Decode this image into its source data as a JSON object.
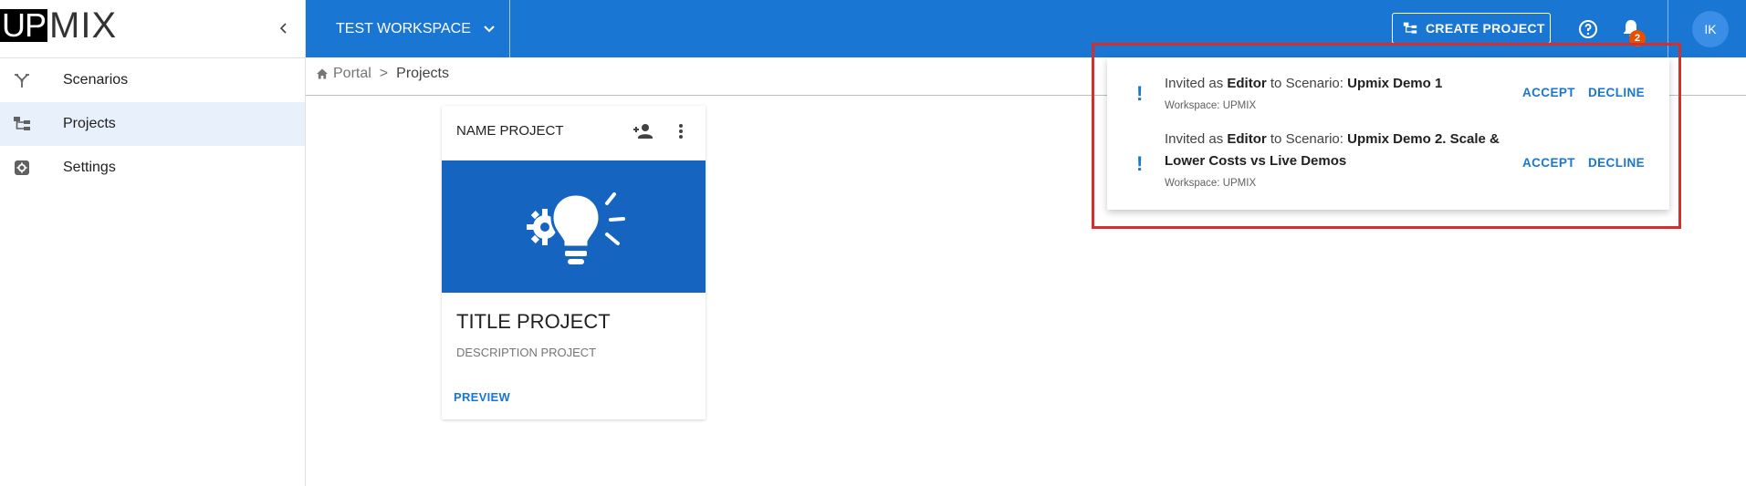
{
  "brand": {
    "logo_part1": "UP",
    "logo_part2": "MIX"
  },
  "sidebar": {
    "items": [
      {
        "label": "Scenarios",
        "icon": "scenarios-icon",
        "active": false
      },
      {
        "label": "Projects",
        "icon": "projects-icon",
        "active": true
      },
      {
        "label": "Settings",
        "icon": "settings-icon",
        "active": false
      }
    ]
  },
  "topbar": {
    "workspace_label": "TEST WORKSPACE",
    "create_project_label": "CREATE PROJECT",
    "notification_count": "2",
    "avatar_initials": "IK",
    "bar_color": "#1976d2"
  },
  "breadcrumb": {
    "home": "Portal",
    "separator": ">",
    "current": "Projects"
  },
  "project_card": {
    "header": "NAME PROJECT",
    "title": "TITLE PROJECT",
    "description": "DESCRIPTION PROJECT",
    "preview_label": "PREVIEW",
    "image_color": "#1565c0",
    "image_icon": "lightbulb-gear-icon"
  },
  "notifications": [
    {
      "prefix": "Invited as ",
      "role": "Editor",
      "middle": " to Scenario: ",
      "scenario": "Upmix Demo 1",
      "workspace": "Workspace: UPMIX",
      "accept": "ACCEPT",
      "decline": "DECLINE"
    },
    {
      "prefix": "Invited as ",
      "role": "Editor",
      "middle": " to Scenario: ",
      "scenario": "Upmix Demo 2. Scale & Lower Costs vs Live Demos",
      "workspace": "Workspace: UPMIX",
      "accept": "ACCEPT",
      "decline": "DECLINE"
    }
  ],
  "highlight_color": "#d32f2f"
}
